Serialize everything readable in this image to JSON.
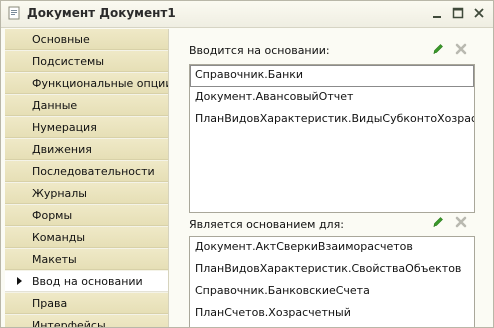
{
  "window": {
    "title": "Документ Документ1"
  },
  "sidebar": {
    "items": [
      {
        "label": "Основные"
      },
      {
        "label": "Подсистемы"
      },
      {
        "label": "Функциональные опции"
      },
      {
        "label": "Данные"
      },
      {
        "label": "Нумерация"
      },
      {
        "label": "Движения"
      },
      {
        "label": "Последовательности"
      },
      {
        "label": "Журналы"
      },
      {
        "label": "Формы"
      },
      {
        "label": "Команды"
      },
      {
        "label": "Макеты"
      },
      {
        "label": "Ввод на основании"
      },
      {
        "label": "Права"
      },
      {
        "label": "Интерфейсы"
      }
    ],
    "active_index": 11
  },
  "based_on": {
    "label": "Вводится на основании:",
    "items": [
      {
        "label": "Справочник.Банки"
      },
      {
        "label": "Документ.АвансовыйОтчет"
      },
      {
        "label": "ПланВидовХарактеристик.ВидыСубконтоХозрасчет..."
      }
    ]
  },
  "basis_for": {
    "label": "Является основанием для:",
    "items": [
      {
        "label": "Документ.АктСверкиВзаиморасчетов"
      },
      {
        "label": "ПланВидовХарактеристик.СвойстваОбъектов"
      },
      {
        "label": "Справочник.БанковскиеСчета"
      },
      {
        "label": "ПланСчетов.Хозрасчетный"
      }
    ]
  },
  "icons": {
    "edit": "pencil-icon",
    "clear": "clear-x-icon",
    "app": "metadata-object-icon",
    "minimize": "minimize-icon",
    "maximize": "maximize-icon",
    "close": "close-icon"
  },
  "colors": {
    "pencil": "#3a9a2a",
    "clear_x": "#b9b9b0",
    "tab_fill": "#ebe4bd",
    "active_tab": "#ffffff"
  }
}
